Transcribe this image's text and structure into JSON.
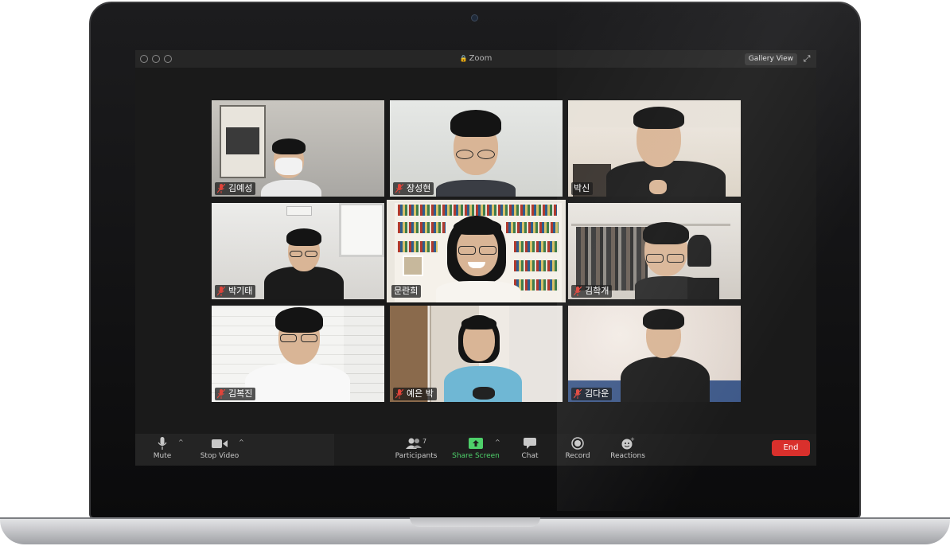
{
  "window": {
    "title": "Zoom",
    "view_button": "Gallery View"
  },
  "participants": [
    {
      "name": "김예성",
      "muted": true
    },
    {
      "name": "장성현",
      "muted": true
    },
    {
      "name": "박신",
      "muted": false
    },
    {
      "name": "박기태",
      "muted": true
    },
    {
      "name": "문란희",
      "muted": false,
      "active_speaker": true
    },
    {
      "name": "김학개",
      "muted": true
    },
    {
      "name": "김복진",
      "muted": true
    },
    {
      "name": "예은 박",
      "muted": true
    },
    {
      "name": "김다운",
      "muted": true
    }
  ],
  "toolbar": {
    "mute": "Mute",
    "stop_video": "Stop Video",
    "participants": "Participants",
    "participants_count": "7",
    "share_screen": "Share Screen",
    "chat": "Chat",
    "record": "Record",
    "reactions": "Reactions",
    "end": "End"
  },
  "colors": {
    "accent_green": "#4ed06a",
    "active_border": "#9cd83a",
    "end_red": "#d9302c",
    "muted_red": "#e0443a"
  },
  "icons": {
    "mic": "mic-icon",
    "video": "video-camera-icon",
    "participants": "people-icon",
    "share": "share-screen-icon",
    "chat": "chat-bubble-icon",
    "record": "record-icon",
    "reactions": "emoji-plus-icon",
    "muted": "mic-off-icon"
  }
}
